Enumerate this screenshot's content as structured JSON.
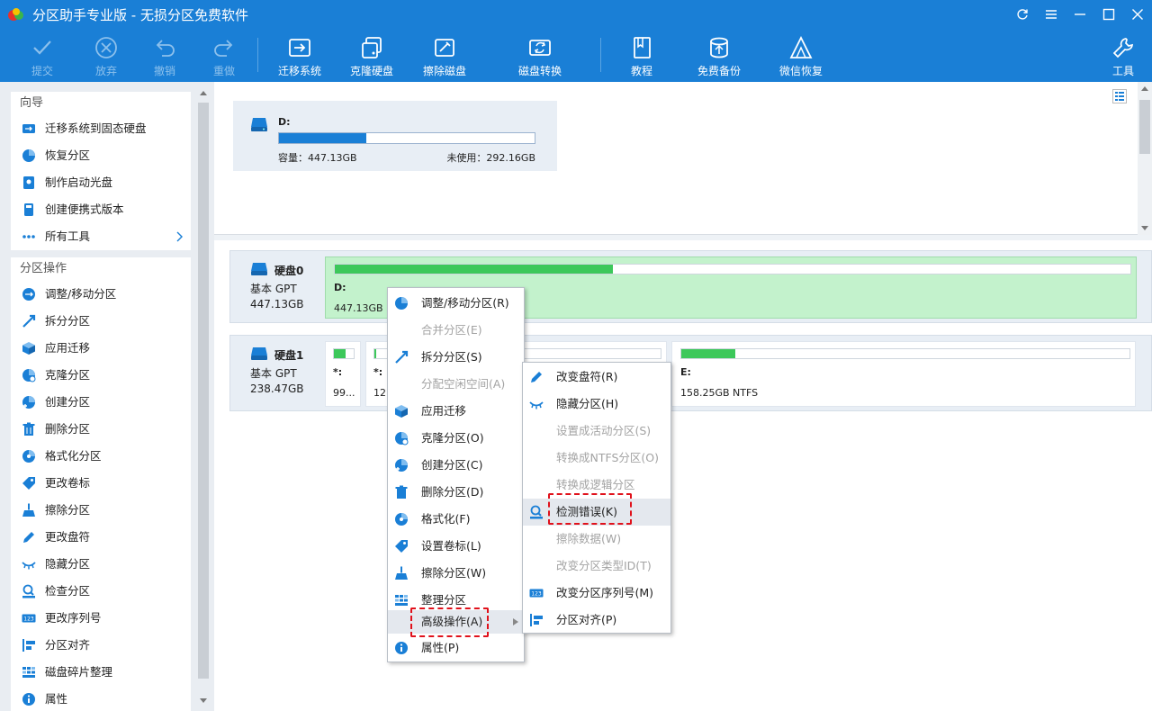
{
  "window": {
    "title": "分区助手专业版 - 无损分区免费软件"
  },
  "toolbar": {
    "commit": "提交",
    "discard": "放弃",
    "undo": "撤销",
    "redo": "重做",
    "migrate_os": "迁移系统",
    "clone_disk": "克隆硬盘",
    "wipe_disk": "擦除磁盘",
    "disk_convert": "磁盘转换",
    "tutorial": "教程",
    "free_backup": "免费备份",
    "wechat_recovery": "微信恢复",
    "tools": "工具"
  },
  "sidebar": {
    "wizard_title": "向导",
    "wizard_items": [
      "迁移系统到固态硬盘",
      "恢复分区",
      "制作启动光盘",
      "创建便携式版本",
      "所有工具"
    ],
    "ops_title": "分区操作",
    "ops_items": [
      "调整/移动分区",
      "拆分分区",
      "应用迁移",
      "克隆分区",
      "创建分区",
      "删除分区",
      "格式化分区",
      "更改卷标",
      "擦除分区",
      "更改盘符",
      "隐藏分区",
      "检查分区",
      "更改序列号",
      "分区对齐",
      "磁盘碎片整理",
      "属性"
    ]
  },
  "volume_card": {
    "name": "D:",
    "capacity": "容量：447.13GB",
    "free": "未使用：292.16GB",
    "used_fraction": 0.34
  },
  "disks": [
    {
      "name": "硬盘0",
      "type": "基本 GPT",
      "size": "447.13GB",
      "partitions": [
        {
          "label": "D:",
          "info": "447.13GB NTFS",
          "used_fraction": 0.35
        }
      ]
    },
    {
      "name": "硬盘1",
      "type": "基本 GPT",
      "size": "238.47GB",
      "partitions": [
        {
          "label": "*:",
          "info": "99...",
          "used_fraction": 0.6
        },
        {
          "label": "*:",
          "info": "12...",
          "used_fraction": 0.1
        },
        {
          "label": "",
          "info": "",
          "used_fraction": 0.35
        },
        {
          "label": "E:",
          "info": "158.25GB NTFS",
          "used_fraction": 0.12
        }
      ]
    }
  ],
  "context_menu": {
    "items": [
      {
        "label": "调整/移动分区(R)",
        "enabled": true
      },
      {
        "label": "合并分区(E)",
        "enabled": false
      },
      {
        "label": "拆分分区(S)",
        "enabled": true
      },
      {
        "label": "分配空闲空间(A)",
        "enabled": false
      },
      {
        "label": "应用迁移",
        "enabled": true
      },
      {
        "label": "克隆分区(O)",
        "enabled": true
      },
      {
        "label": "创建分区(C)",
        "enabled": true
      },
      {
        "label": "删除分区(D)",
        "enabled": true
      },
      {
        "label": "格式化(F)",
        "enabled": true
      },
      {
        "label": "设置卷标(L)",
        "enabled": true
      },
      {
        "label": "擦除分区(W)",
        "enabled": true
      },
      {
        "label": "整理分区",
        "enabled": true
      },
      {
        "label": "高级操作(A)",
        "enabled": true
      },
      {
        "label": "属性(P)",
        "enabled": true
      }
    ]
  },
  "submenu": {
    "items": [
      {
        "label": "改变盘符(R)",
        "enabled": true
      },
      {
        "label": "隐藏分区(H)",
        "enabled": true
      },
      {
        "label": "设置成活动分区(S)",
        "enabled": false
      },
      {
        "label": "转换成NTFS分区(O)",
        "enabled": false
      },
      {
        "label": "转换成逻辑分区",
        "enabled": false
      },
      {
        "label": "检测错误(K)",
        "enabled": true
      },
      {
        "label": "擦除数据(W)",
        "enabled": false
      },
      {
        "label": "改变分区类型ID(T)",
        "enabled": false
      },
      {
        "label": "改变分区序列号(M)",
        "enabled": true
      },
      {
        "label": "分区对齐(P)",
        "enabled": true
      }
    ]
  },
  "colors": {
    "accent": "#1a7fd6",
    "used_bar": "#3cc85a",
    "selected_partition": "#c3f2cc",
    "highlight_dash": "#e0111b"
  }
}
